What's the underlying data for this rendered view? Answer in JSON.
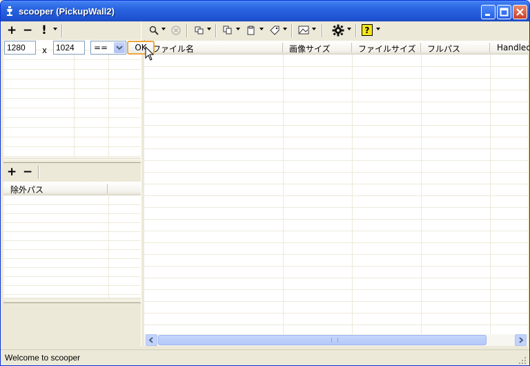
{
  "window": {
    "title": "scooper (PickupWall2)",
    "accent": "#0a246a",
    "titlebar_color": "#2a64e0"
  },
  "left_toolbar": {
    "add_label": "+",
    "remove_label": "−",
    "priority_label": "!"
  },
  "filter": {
    "width_value": "1280",
    "separator": "x",
    "height_value": "1024",
    "operator_value": "==",
    "ok_label": "OK"
  },
  "exclude_toolbar": {
    "add_label": "+",
    "remove_label": "−"
  },
  "exclude_table": {
    "columns": [
      "除外パス"
    ]
  },
  "file_table": {
    "columns": [
      "ファイル名",
      "画像サイズ",
      "ファイルサイズ",
      "フルパス",
      "Handled"
    ]
  },
  "right_toolbar": {
    "icons": [
      "search-icon",
      "stop-icon",
      "copy-icon",
      "move-icon",
      "clipboard-icon",
      "tag-icon",
      "image-icon",
      "gear-icon",
      "help-icon"
    ]
  },
  "statusbar": {
    "text": "Welcome to scooper"
  }
}
